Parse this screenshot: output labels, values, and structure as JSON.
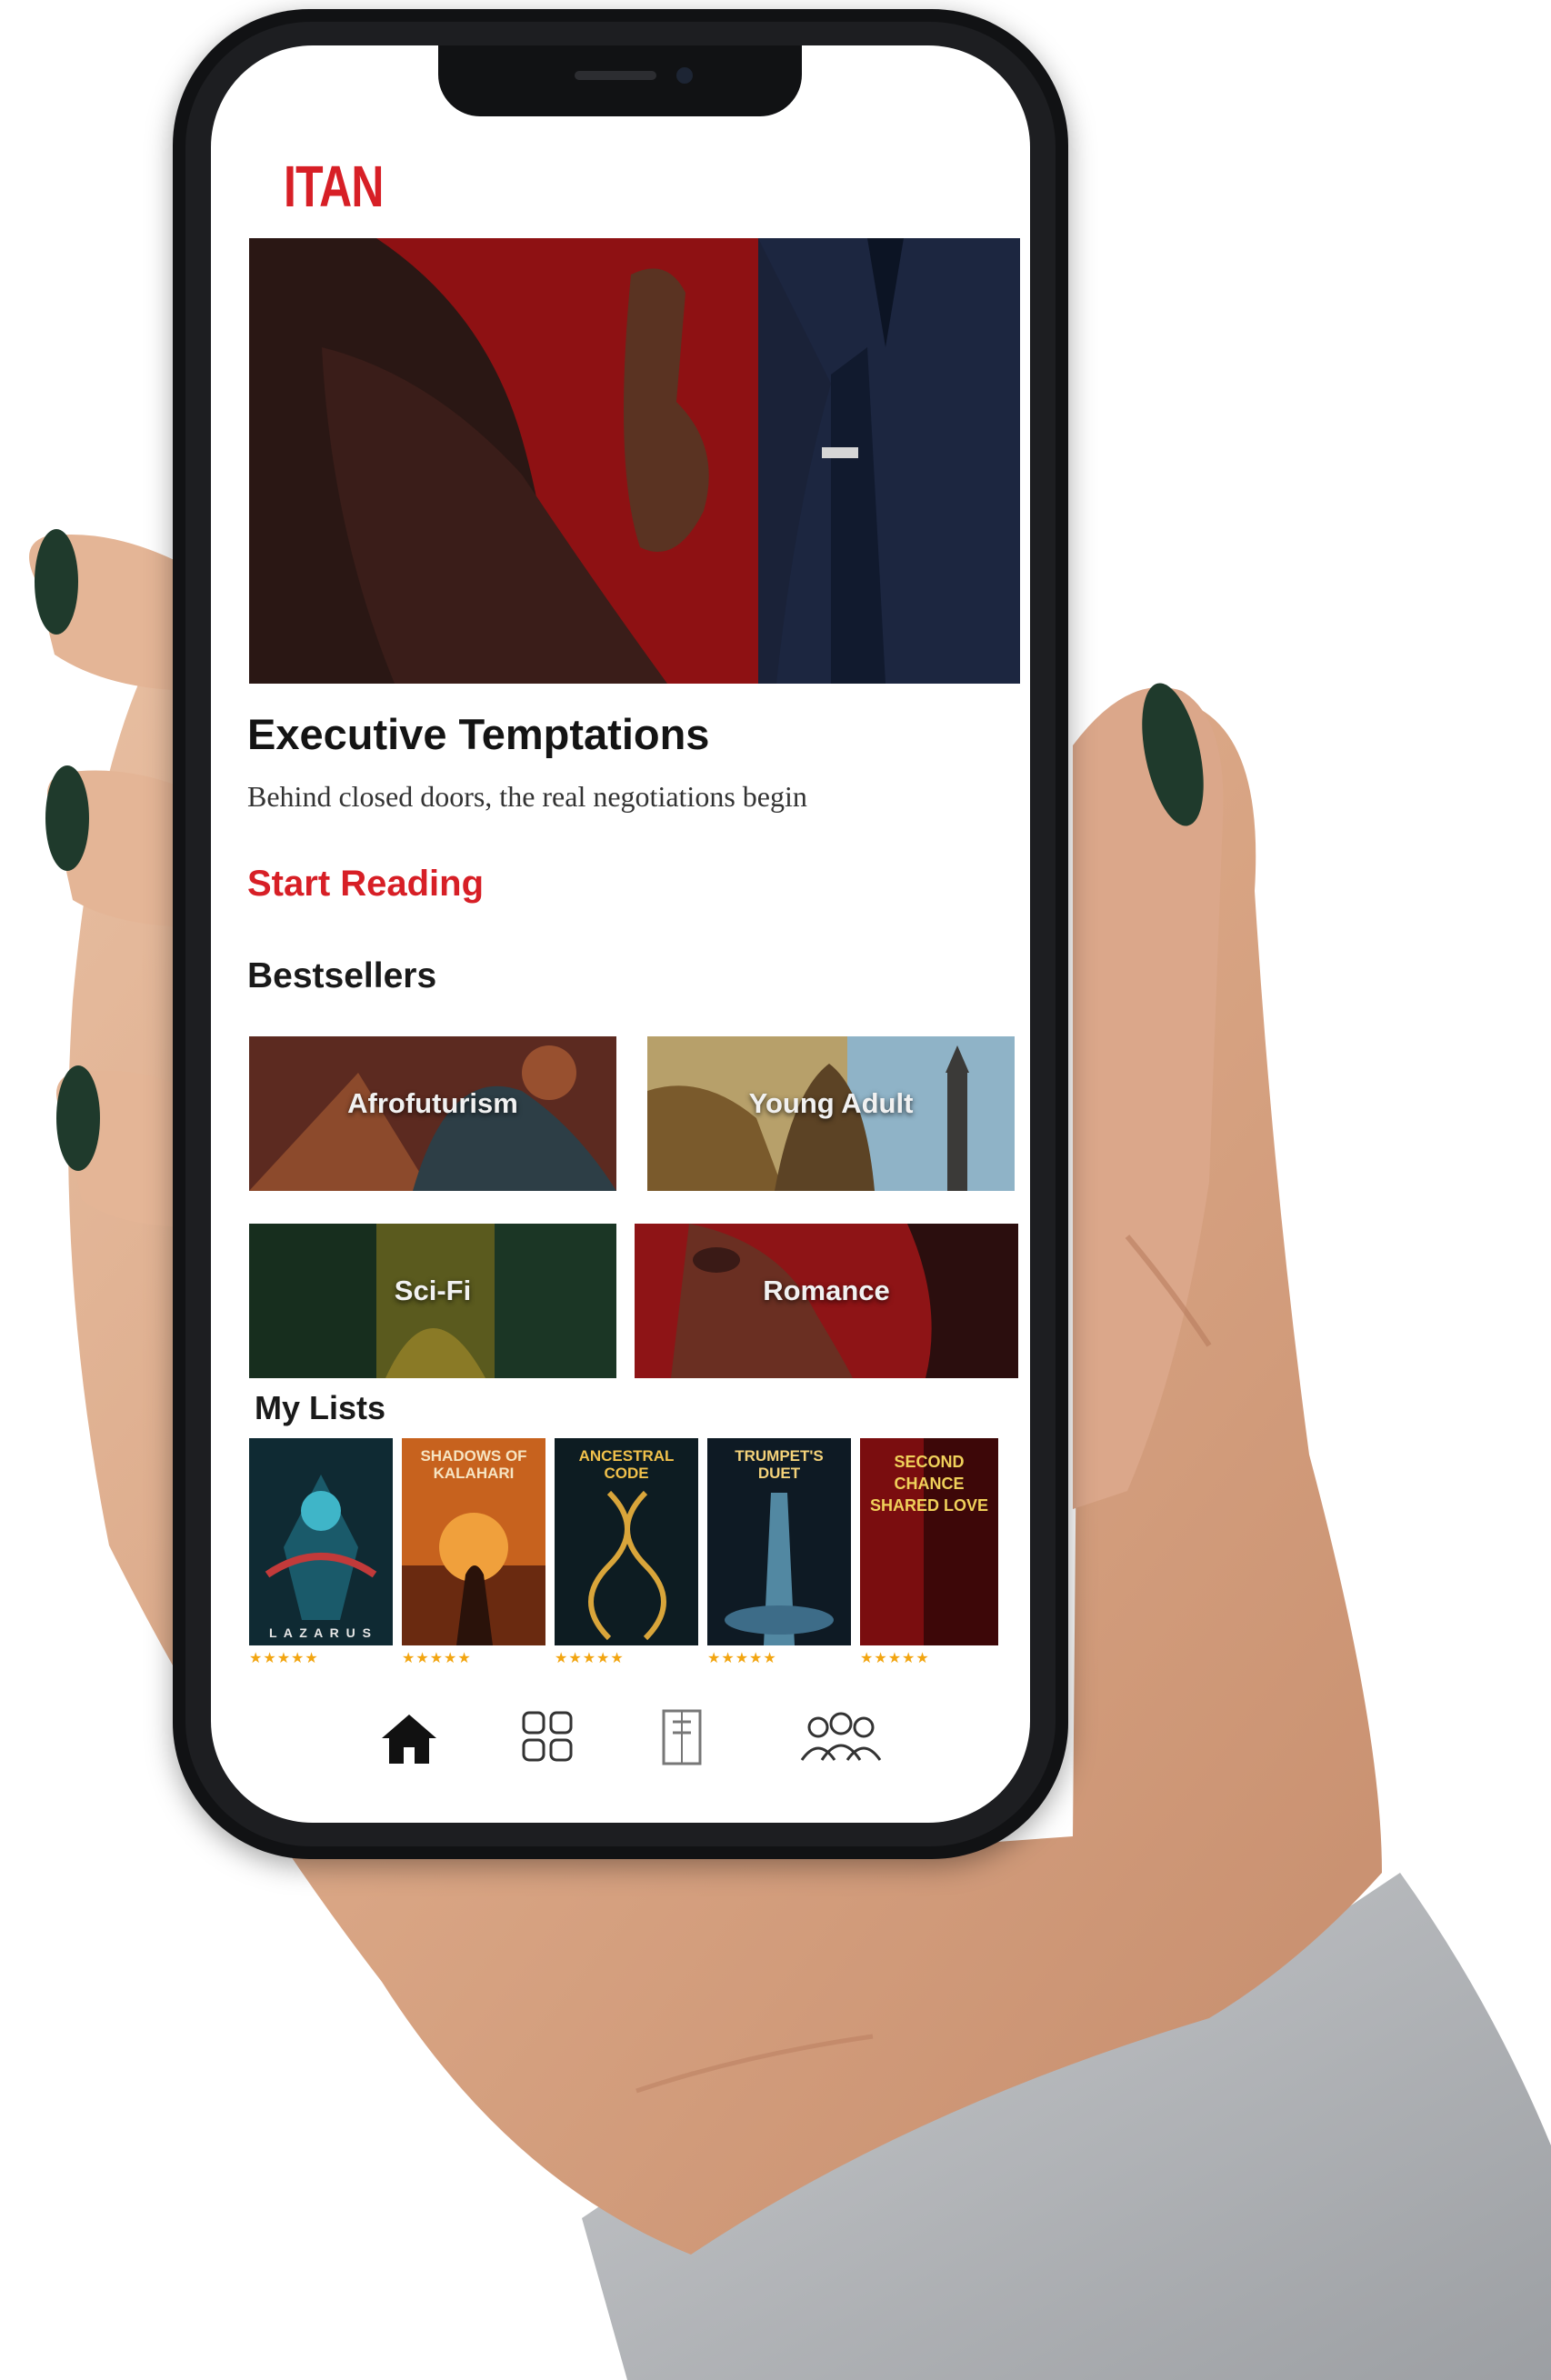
{
  "app": {
    "logo_text": "ITAN",
    "brand_color": "#d71f26"
  },
  "hero": {
    "title": "Executive Temptations",
    "tagline": "Behind closed doors, the real negotiations begin",
    "cta_label": "Start Reading"
  },
  "bestsellers": {
    "section_title": "Bestsellers",
    "genres": [
      {
        "label": "Afrofuturism"
      },
      {
        "label": "Young Adult"
      },
      {
        "label": "Sci-Fi"
      },
      {
        "label": "Romance"
      }
    ]
  },
  "my_lists": {
    "section_title": "My Lists",
    "books": [
      {
        "title": "",
        "author": "L A Z A R U S",
        "rating": 5
      },
      {
        "title": "Shadows of Kalahari",
        "author": "",
        "rating": 5
      },
      {
        "title": "Ancestral Code",
        "author": "",
        "rating": 5
      },
      {
        "title": "Trumpet's Duet",
        "author": "",
        "rating": 5
      },
      {
        "title": "Second Chance Shared Love",
        "author": "",
        "rating": 5
      }
    ]
  },
  "bottom_nav": {
    "items": [
      {
        "icon": "home-icon"
      },
      {
        "icon": "grid-icon"
      },
      {
        "icon": "library-icon"
      },
      {
        "icon": "community-icon"
      }
    ]
  },
  "colors": {
    "rating_star": "#f2a511",
    "nail_polish": "#1f3a2c",
    "sleeve": "#b9bcbf"
  }
}
